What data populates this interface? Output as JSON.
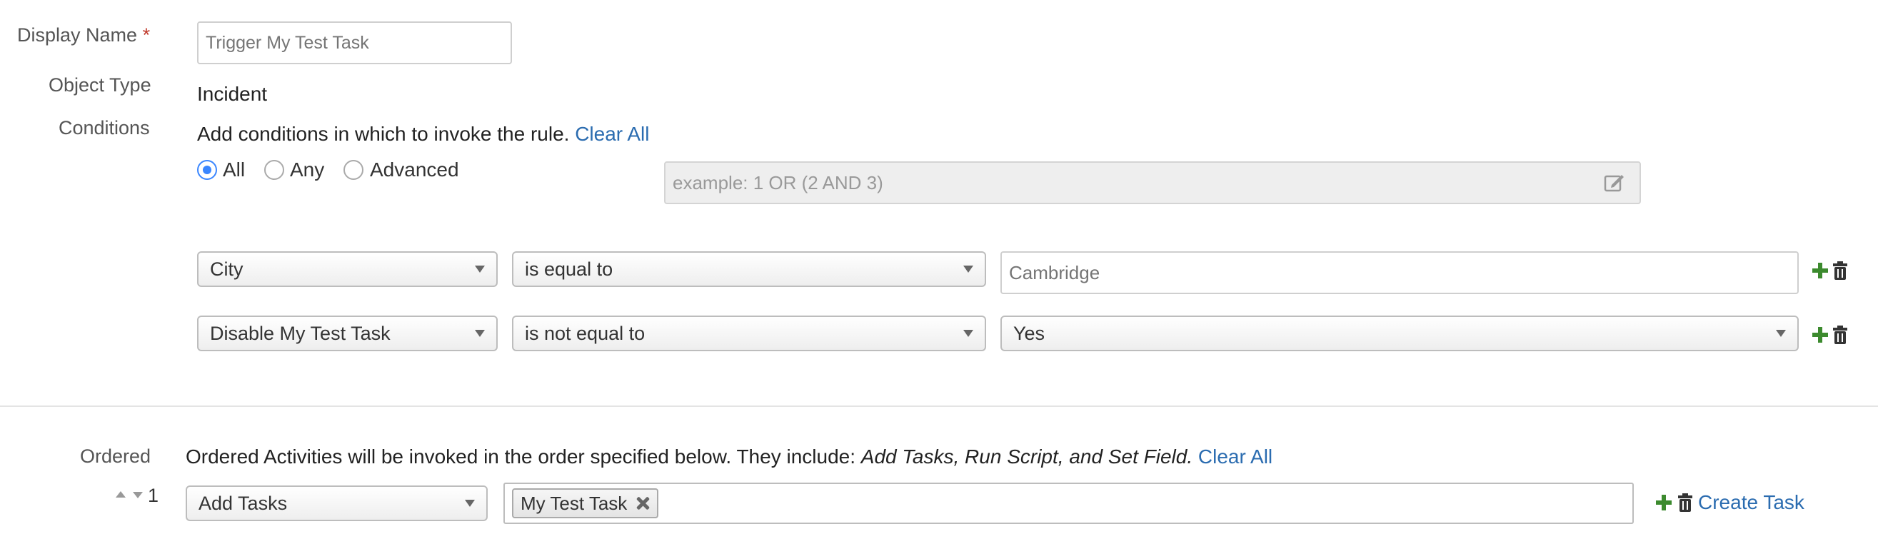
{
  "form": {
    "display_name_label": "Display Name",
    "required_mark": "*",
    "display_name_placeholder": "Trigger My Test Task",
    "object_type_label": "Object Type",
    "object_type_value": "Incident",
    "conditions_label": "Conditions"
  },
  "conditions": {
    "intro": "Add conditions in which to invoke the rule.",
    "clear_all": "Clear All",
    "modes": [
      {
        "label": "All",
        "selected": true
      },
      {
        "label": "Any",
        "selected": false
      },
      {
        "label": "Advanced",
        "selected": false
      }
    ],
    "advanced_placeholder": "example: 1 OR (2 AND 3)",
    "rows": [
      {
        "field": "City",
        "operator": "is equal to",
        "value": "Cambridge",
        "value_type": "text"
      },
      {
        "field": "Disable My Test Task",
        "operator": "is not equal to",
        "value": "Yes",
        "value_type": "select"
      }
    ]
  },
  "ordered": {
    "label": "Ordered",
    "description_prefix": "Ordered Activities will be invoked in the order specified below. They include:",
    "description_italic": "Add Tasks, Run Script, and Set Field.",
    "clear_all": "Clear All",
    "rows": [
      {
        "index": "1",
        "activity": "Add Tasks",
        "tags": [
          "My Test Task"
        ],
        "action_label": "Create Task"
      }
    ]
  },
  "colors": {
    "link": "#2b6cb0",
    "required": "#c0392b",
    "add": "#3c8a2e",
    "radio_selected": "#3a86ff"
  },
  "icons": [
    "plus-icon",
    "trash-icon",
    "edit-icon",
    "remove-tag-icon",
    "move-up-icon",
    "move-down-icon",
    "dropdown-caret-icon"
  ]
}
